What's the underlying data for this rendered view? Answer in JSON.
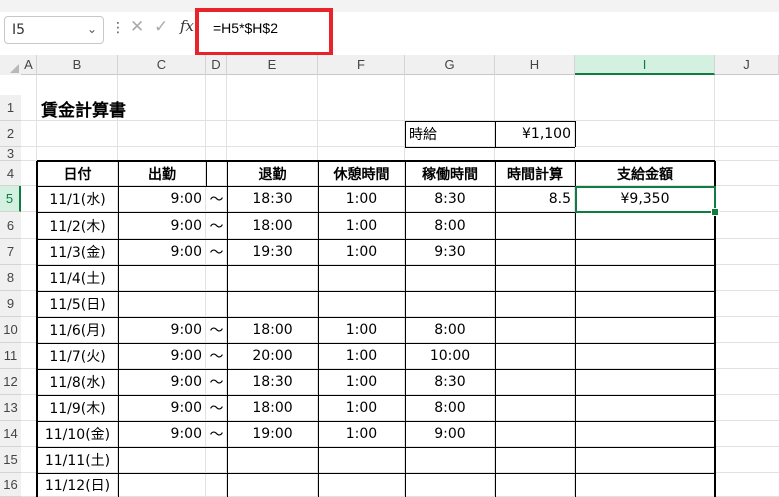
{
  "formula_bar": {
    "name_box": "I5",
    "formula": "=H5*$H$2",
    "fx_label": "fx",
    "icons": {
      "cancel": "close-icon",
      "enter": "check-icon",
      "more": "more-vertical-icon",
      "dropdown": "chevron-down-icon"
    }
  },
  "highlight_color": "#e8232a",
  "selection_color": "#107c41",
  "columns": [
    "A",
    "B",
    "C",
    "D",
    "E",
    "F",
    "G",
    "H",
    "I",
    "J"
  ],
  "rows": [
    "1",
    "2",
    "3",
    "4",
    "5",
    "6",
    "7",
    "8",
    "9",
    "10",
    "11",
    "12",
    "13",
    "14",
    "15",
    "16"
  ],
  "sheet": {
    "title": "賃金計算書",
    "wage_label": "時給",
    "wage_value": "¥1,100",
    "headers": [
      "日付",
      "出勤",
      "",
      "退勤",
      "休憩時間",
      "稼働時間",
      "時間計算",
      "支給金額"
    ],
    "records": [
      {
        "date": "11/1(水)",
        "start": "9:00",
        "tilde": "～",
        "end": "18:30",
        "break": "1:00",
        "work": "8:30",
        "hours": "8.5",
        "pay": "¥9,350"
      },
      {
        "date": "11/2(木)",
        "start": "9:00",
        "tilde": "～",
        "end": "18:00",
        "break": "1:00",
        "work": "8:00",
        "hours": "",
        "pay": ""
      },
      {
        "date": "11/3(金)",
        "start": "9:00",
        "tilde": "～",
        "end": "19:30",
        "break": "1:00",
        "work": "9:30",
        "hours": "",
        "pay": ""
      },
      {
        "date": "11/4(土)",
        "start": "",
        "tilde": "",
        "end": "",
        "break": "",
        "work": "",
        "hours": "",
        "pay": ""
      },
      {
        "date": "11/5(日)",
        "start": "",
        "tilde": "",
        "end": "",
        "break": "",
        "work": "",
        "hours": "",
        "pay": ""
      },
      {
        "date": "11/6(月)",
        "start": "9:00",
        "tilde": "～",
        "end": "18:00",
        "break": "1:00",
        "work": "8:00",
        "hours": "",
        "pay": ""
      },
      {
        "date": "11/7(火)",
        "start": "9:00",
        "tilde": "～",
        "end": "20:00",
        "break": "1:00",
        "work": "10:00",
        "hours": "",
        "pay": ""
      },
      {
        "date": "11/8(水)",
        "start": "9:00",
        "tilde": "～",
        "end": "18:30",
        "break": "1:00",
        "work": "8:30",
        "hours": "",
        "pay": ""
      },
      {
        "date": "11/9(木)",
        "start": "9:00",
        "tilde": "～",
        "end": "18:00",
        "break": "1:00",
        "work": "8:00",
        "hours": "",
        "pay": ""
      },
      {
        "date": "11/10(金)",
        "start": "9:00",
        "tilde": "～",
        "end": "19:00",
        "break": "1:00",
        "work": "9:00",
        "hours": "",
        "pay": ""
      },
      {
        "date": "11/11(土)",
        "start": "",
        "tilde": "",
        "end": "",
        "break": "",
        "work": "",
        "hours": "",
        "pay": ""
      },
      {
        "date": "11/12(日)",
        "start": "",
        "tilde": "",
        "end": "",
        "break": "",
        "work": "",
        "hours": "",
        "pay": ""
      }
    ]
  }
}
